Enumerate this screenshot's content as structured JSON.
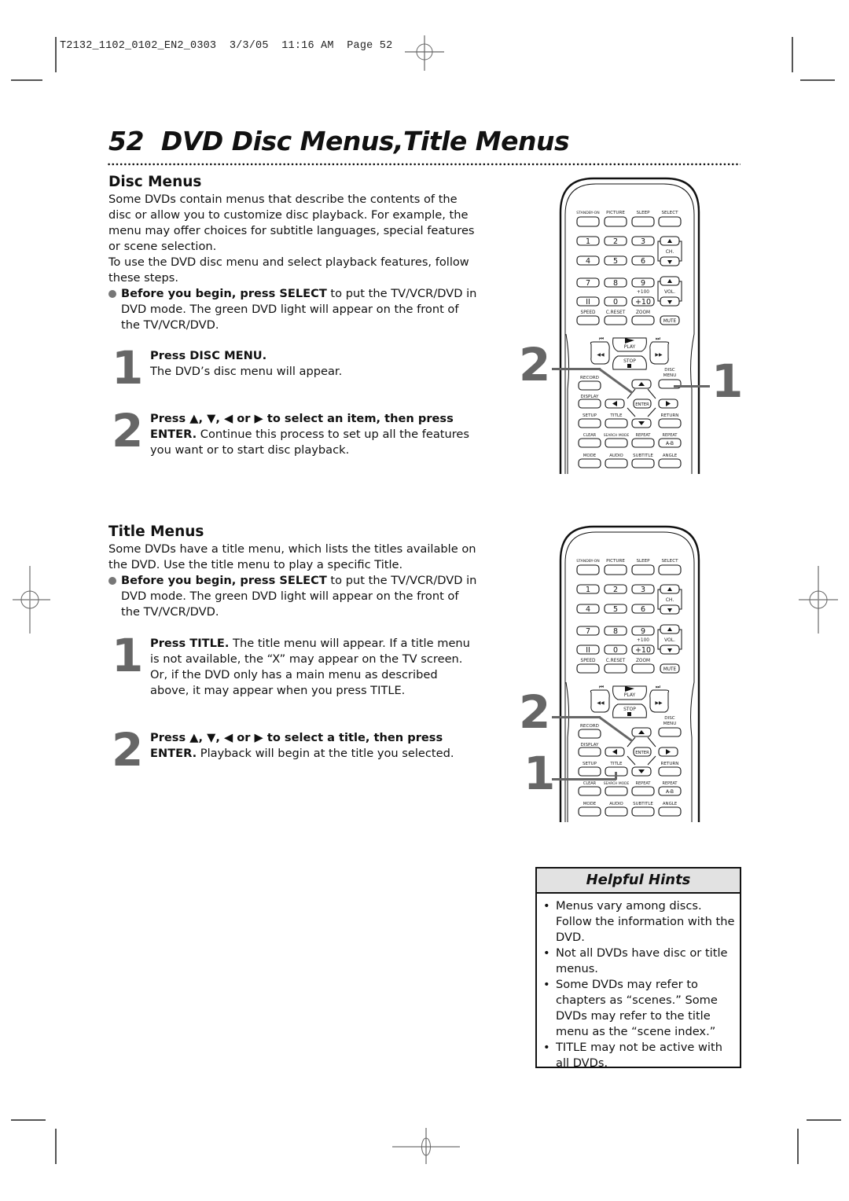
{
  "print_slug": "T2132_1102_0102_EN2_0303  3/3/05  11:16 AM  Page 52",
  "page": {
    "number": "52",
    "title": "DVD Disc Menus,Title Menus"
  },
  "disc_menus": {
    "heading": "Disc Menus",
    "intro": "Some DVDs contain menus that describe the contents of the disc or allow you to customize disc playback.  For example, the menu may offer choices for subtitle languages, special features or scene selection.",
    "intro2": "To use the DVD disc menu and select playback features, follow these steps.",
    "before_bold": "Before you begin, press SELECT",
    "before_rest": " to put the TV/VCR/DVD in DVD mode. The green DVD light will appear on the front of the TV/VCR/DVD.",
    "steps": [
      {
        "num": "1",
        "bold": "Press DISC MENU.",
        "text": "The DVD’s disc menu will appear."
      },
      {
        "num": "2",
        "bold": "Press ▲, ▼, ◀ or ▶  to select an item, then press ENTER.",
        "text": "  Continue this process to set up all the features you want or to start disc playback."
      }
    ]
  },
  "title_menus": {
    "heading": "Title Menus",
    "intro": "Some DVDs have a title menu, which lists the titles available on the DVD.  Use the title menu to play a specific Title.",
    "before_bold": "Before you begin, press SELECT",
    "before_rest": " to put the TV/VCR/DVD in DVD mode. The green DVD light will appear on the front of the TV/VCR/DVD.",
    "steps": [
      {
        "num": "1",
        "bold": "Press TITLE.",
        "text": " The title menu will appear. If a title menu is not available, the “X” may appear on the TV screen. Or, if the DVD only has a main menu as described above, it may appear when you press TITLE."
      },
      {
        "num": "2",
        "bold": "Press ▲, ▼, ◀ or ▶  to select a title, then press ENTER.",
        "text": "  Playback will begin at the title you selected."
      }
    ]
  },
  "remote": {
    "row1": [
      "STANDBY-ON",
      "PICTURE",
      "SLEEP",
      "SELECT"
    ],
    "digits": [
      "1",
      "2",
      "3",
      "4",
      "5",
      "6",
      "7",
      "8",
      "9",
      "II",
      "0",
      "+10"
    ],
    "plus100": "+100",
    "ch_label": "CH.",
    "vol_label": "VOL.",
    "row_speed": [
      "SPEED",
      "C.RESET",
      "ZOOM"
    ],
    "mute": "MUTE",
    "play": "PLAY",
    "stop": "STOP",
    "record": "RECORD",
    "disc_menu_1": "DISC",
    "disc_menu_2": "MENU",
    "display": "DISPLAY",
    "enter": "ENTER",
    "row_setup": [
      "SETUP",
      "TITLE",
      "RETURN"
    ],
    "row_clear": [
      "CLEAR",
      "SEARCH MODE",
      "REPEAT",
      "REPEAT"
    ],
    "ab": "A-B",
    "row_mode": [
      "MODE",
      "AUDIO",
      "SUBTITLE",
      "ANGLE"
    ]
  },
  "callouts": {
    "disc": {
      "left": "2",
      "right": "1"
    },
    "title": {
      "top": "2",
      "bottom": "1"
    }
  },
  "hints": {
    "heading": "Helpful Hints",
    "items": [
      "Menus vary among discs. Follow the information with the DVD.",
      "Not all DVDs have disc or title menus.",
      "Some DVDs may refer to chapters as “scenes.” Some DVDs may refer to the title menu as the “scene index.”",
      "TITLE may not be active with all DVDs."
    ]
  }
}
